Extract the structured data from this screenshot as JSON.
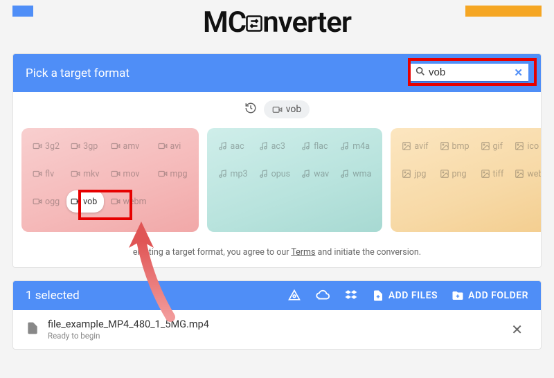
{
  "logo": {
    "part1": "MC",
    "part2": "nverter"
  },
  "picker": {
    "title": "Pick a target format",
    "search_value": "vob",
    "recent_label": "vob",
    "agree_prefix": "electing a target format, you agree to our ",
    "terms_label": "Terms",
    "agree_suffix": " and initiate the conversion."
  },
  "groups": {
    "video": [
      "3g2",
      "3gp",
      "amv",
      "avi",
      "flv",
      "mkv",
      "mov",
      "mpg",
      "ogg",
      "vob",
      "webm"
    ],
    "audio": [
      "aac",
      "ac3",
      "flac",
      "m4a",
      "mp3",
      "opus",
      "wav",
      "wma"
    ],
    "image": [
      "avif",
      "bmp",
      "gif",
      "ico",
      "jpg",
      "png",
      "tiff",
      "webp"
    ]
  },
  "match_format": "vob",
  "queue": {
    "selected_text": "1 selected",
    "add_files_label": "ADD FILES",
    "add_folder_label": "ADD FOLDER"
  },
  "file": {
    "name": "file_example_MP4_480_1_5MG.mp4",
    "status": "Ready to begin"
  }
}
